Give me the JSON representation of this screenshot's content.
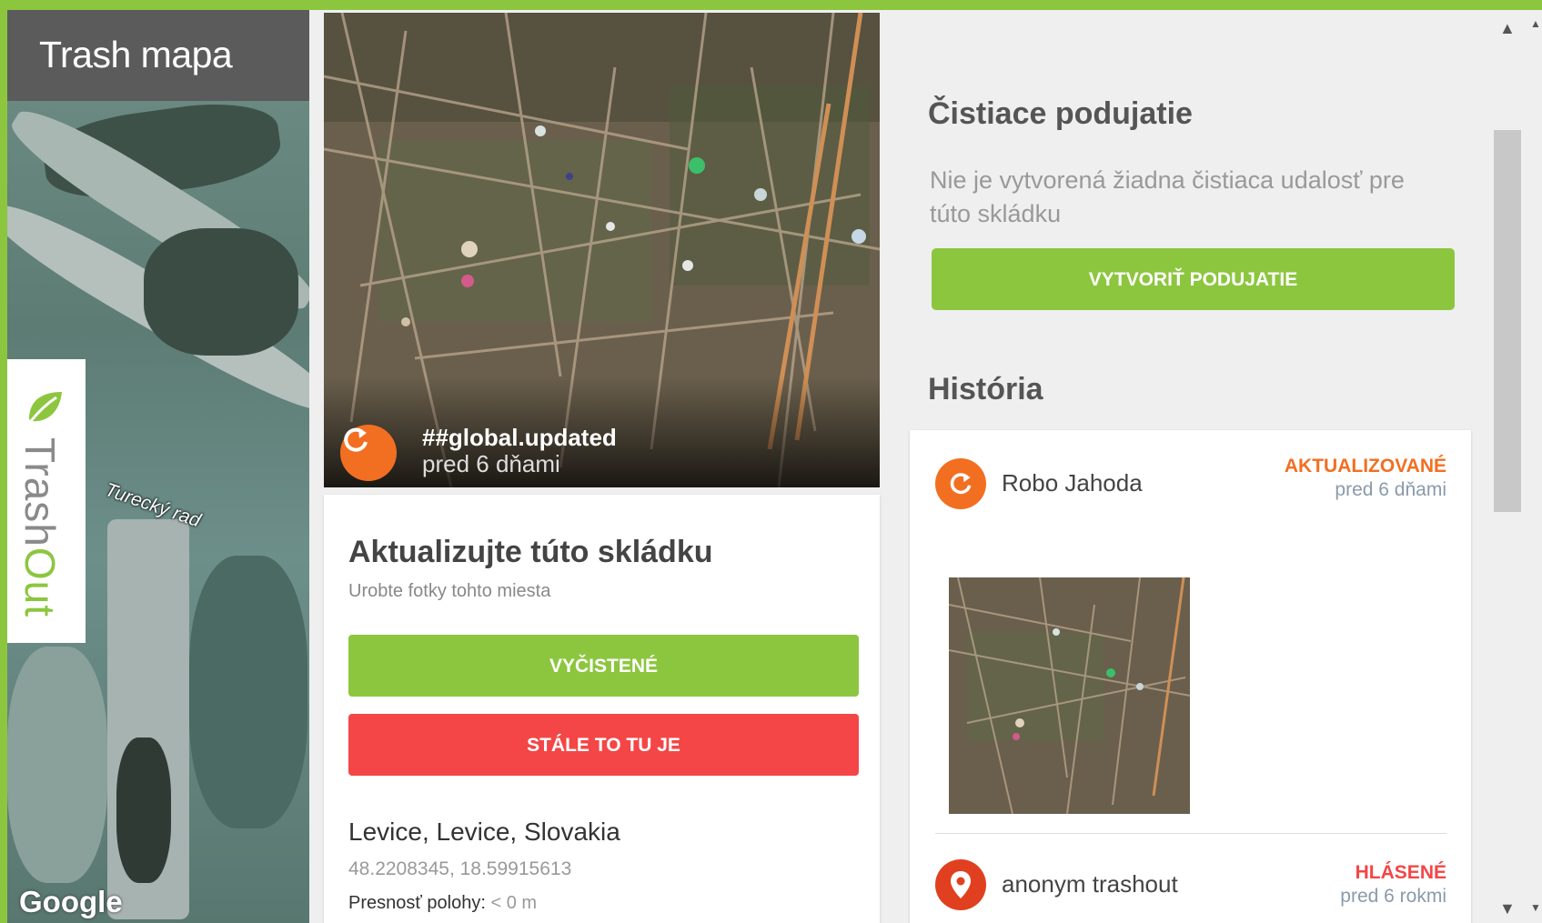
{
  "map": {
    "title": "Trash mapa",
    "street_label": "Turecký rad",
    "brand_name_part1": "Trash",
    "brand_name_part2": "Out",
    "attribution": "Google"
  },
  "photo": {
    "status": "##global.updated",
    "time": "pred 6 dňami",
    "icon": "refresh-icon"
  },
  "update_card": {
    "title": "Aktualizujte túto skládku",
    "subtitle": "Urobte fotky tohto miesta",
    "cleaned_label": "VYČISTENÉ",
    "still_here_label": "STÁLE TO TU JE",
    "location": "Levice, Levice, Slovakia",
    "coordinates": "48.2208345, 18.59915613",
    "accuracy_label": "Presnosť polohy:",
    "accuracy_value": "< 0 m"
  },
  "cleaning": {
    "title": "Čistiace podujatie",
    "empty_text": "Nie je vytvorená žiadna čistiaca udalosť pre túto skládku",
    "create_label": "VYTVORIŤ PODUJATIE"
  },
  "history": {
    "title": "História",
    "items": [
      {
        "user": "Robo Jahoda",
        "status": "AKTUALIZOVANÉ",
        "time": "pred 6 dňami",
        "icon": "refresh-icon"
      },
      {
        "user": "anonym trashout",
        "status": "HLÁSENÉ",
        "time": "pred 6 rokmi",
        "icon": "location-pin-icon"
      }
    ]
  },
  "colors": {
    "brand_green": "#8cc63f",
    "alert_red": "#f44646",
    "update_orange": "#f26f22",
    "pin_red": "#e0401f"
  }
}
